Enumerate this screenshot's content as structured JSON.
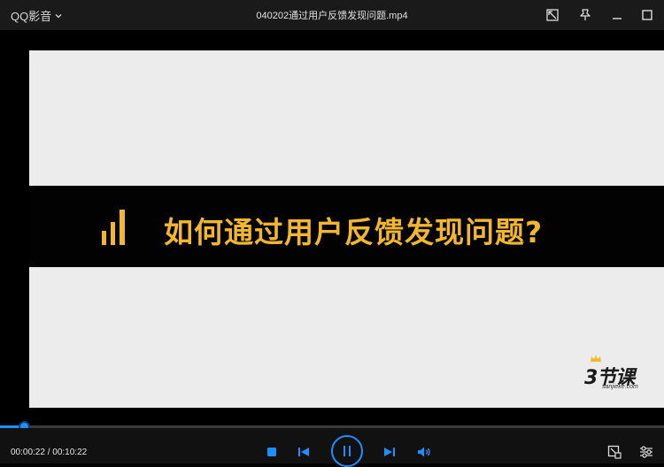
{
  "app": {
    "name": "QQ影音",
    "file_title": "040202通过用户反馈发现问题.mp4"
  },
  "video": {
    "headline": "如何通过用户反馈发现问题?",
    "logo_main": "3节课",
    "logo_sub": "sanjieke.com",
    "headline_color": "#f2b72e"
  },
  "player": {
    "current_time": "00:00:22",
    "total_time": "00:10:22",
    "time_display": "00:00:22 / 00:10:22",
    "progress_fraction": 0.0354,
    "accent_color": "#1e8fff"
  },
  "icons": {
    "titlebar": [
      "screenshot-icon",
      "pin-icon",
      "minimize-icon",
      "maximize-icon"
    ],
    "controls": [
      "stop-icon",
      "previous-icon",
      "pause-icon",
      "next-icon",
      "volume-icon",
      "capture-icon",
      "settings-icon"
    ]
  }
}
